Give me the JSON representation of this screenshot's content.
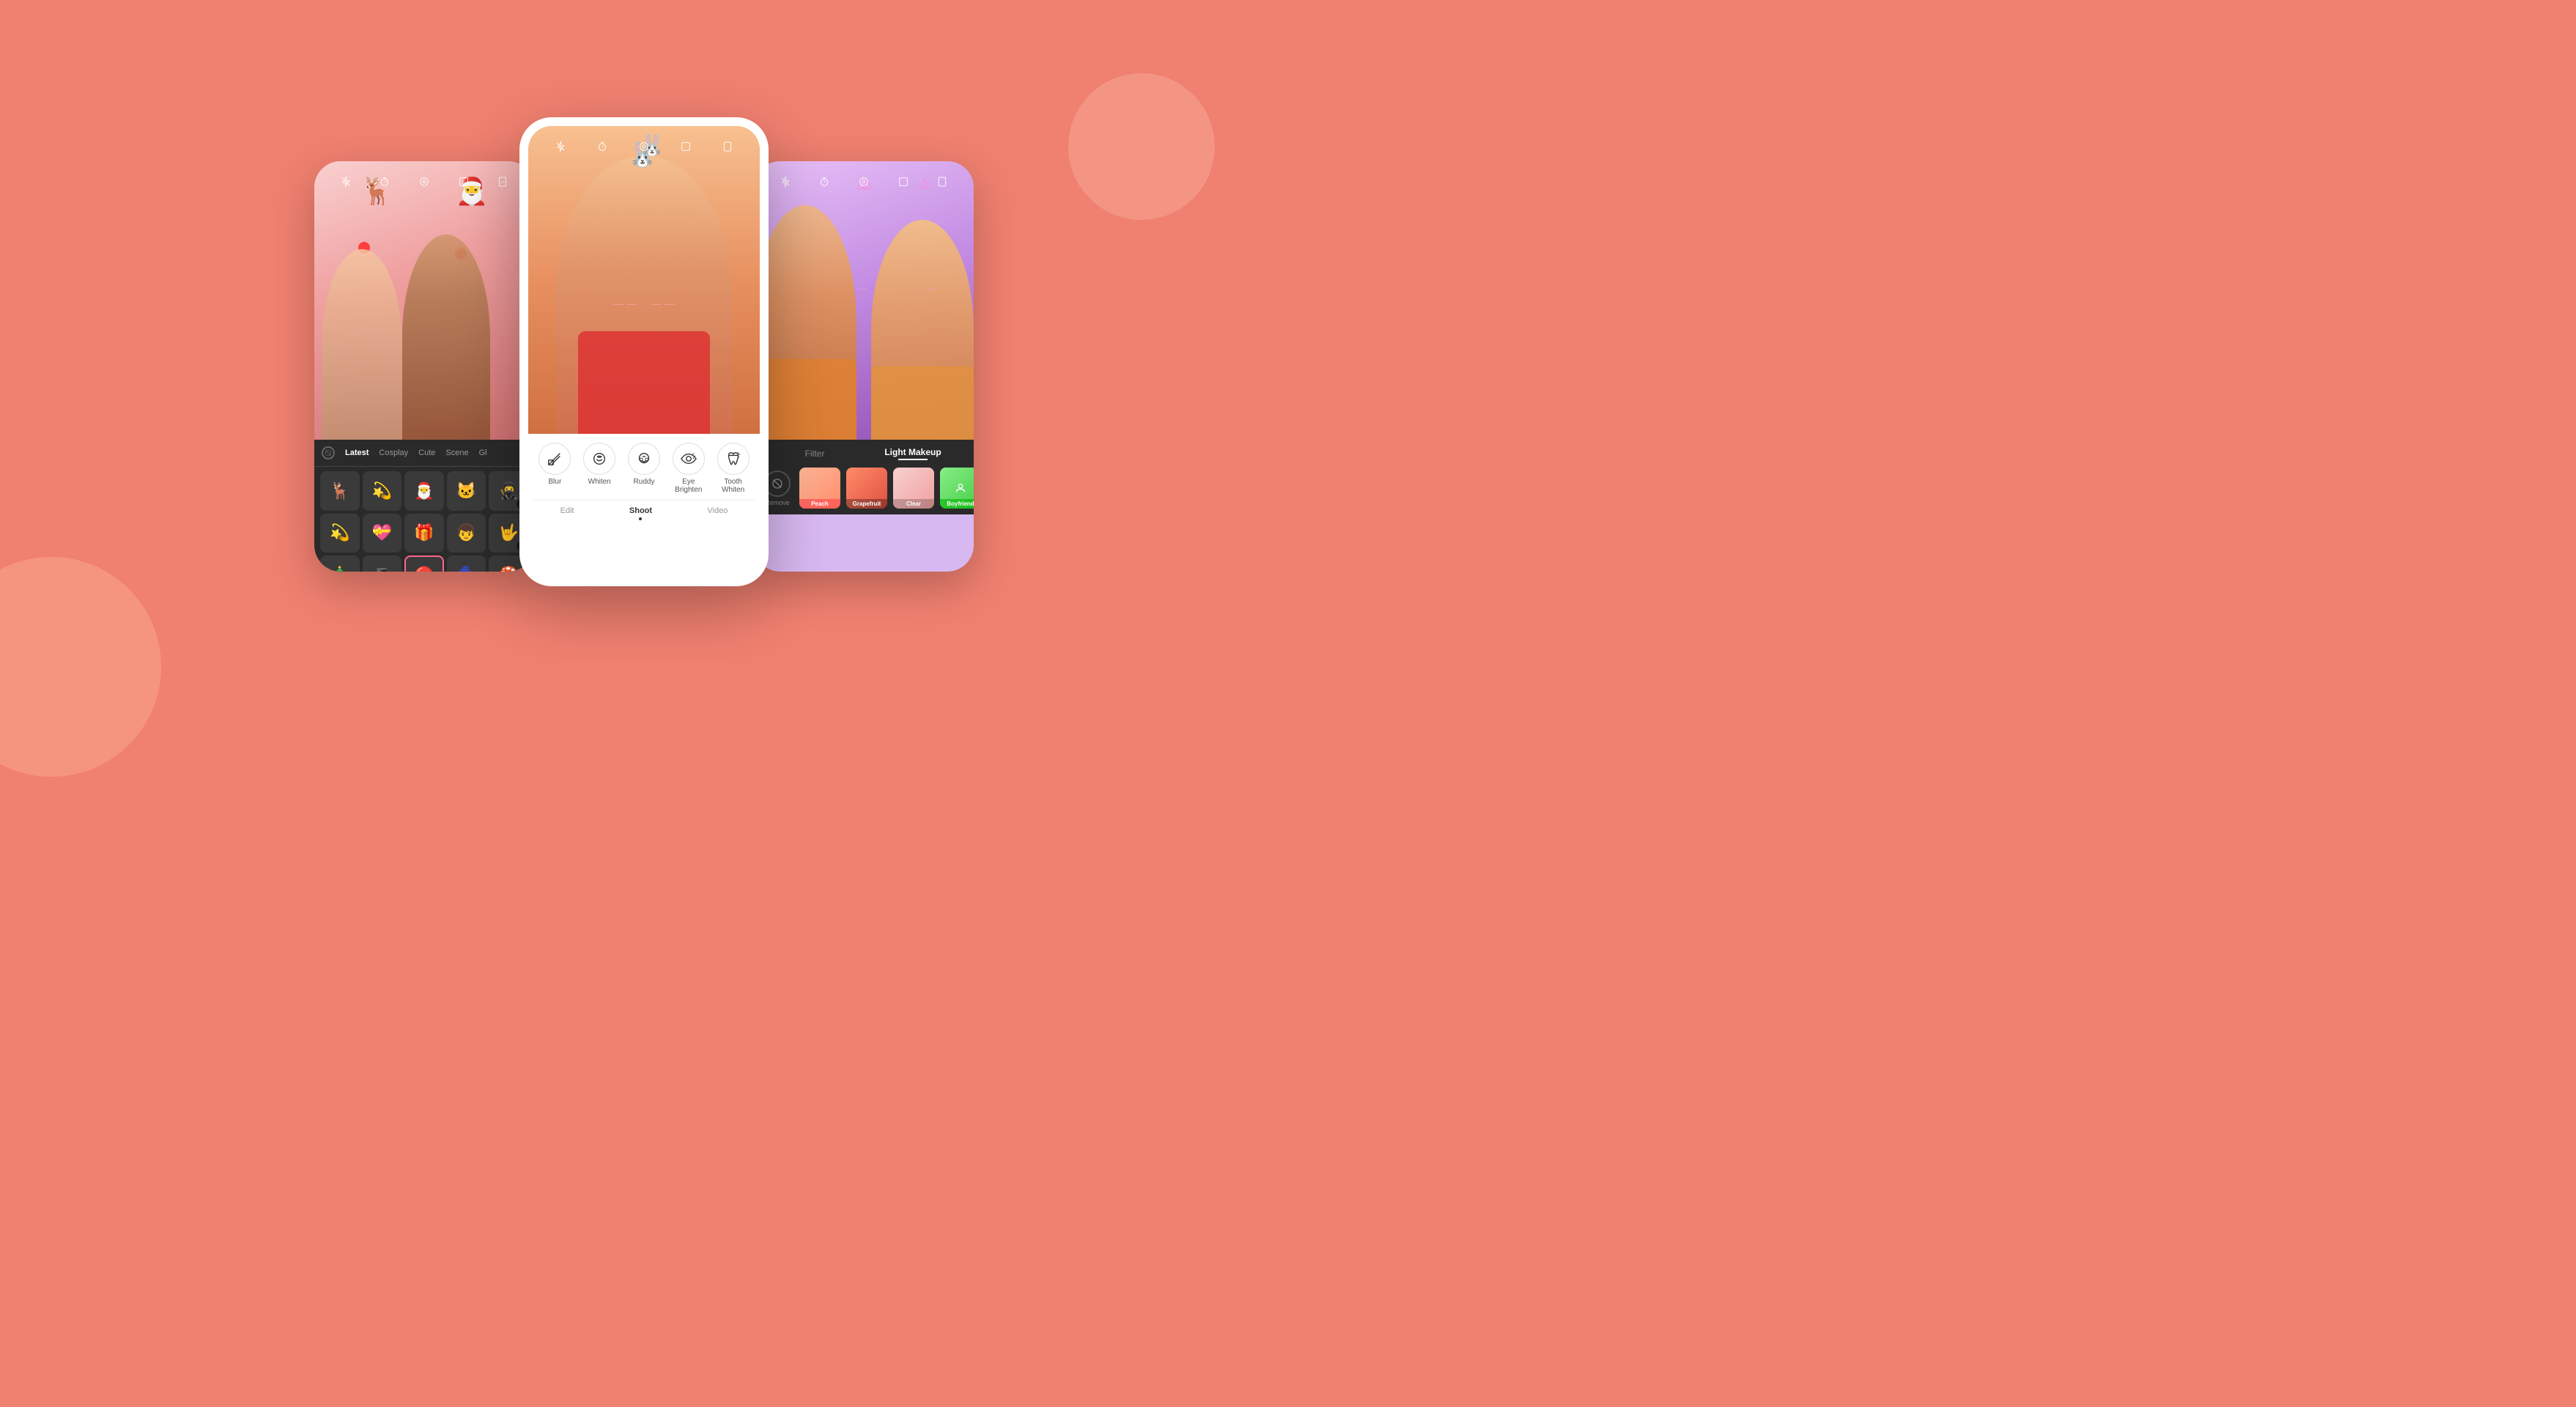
{
  "background": {
    "color": "#f08070"
  },
  "left_phone": {
    "bg_color": "#f8c0c0",
    "filter_tabs": {
      "no_filter_label": "⊘",
      "tabs": [
        "Latest",
        "Cosplay",
        "Cute",
        "Scene",
        "Gl"
      ]
    },
    "stickers": [
      {
        "emoji": "🎄",
        "downloaded": false
      },
      {
        "emoji": "🦌",
        "downloaded": false
      },
      {
        "emoji": "🎅",
        "downloaded": false
      },
      {
        "emoji": "🐱",
        "downloaded": false
      },
      {
        "emoji": "🥷",
        "downloaded": true
      },
      {
        "emoji": "💫",
        "downloaded": false
      },
      {
        "emoji": "💝",
        "downloaded": false
      },
      {
        "emoji": "🎁",
        "downloaded": false
      },
      {
        "emoji": "👦",
        "downloaded": false
      },
      {
        "emoji": "🤟",
        "downloaded": true
      },
      {
        "emoji": "🎄",
        "downloaded": false
      },
      {
        "emoji": "🎩",
        "downloaded": true
      },
      {
        "emoji": "🔴",
        "downloaded": false,
        "selected": true
      },
      {
        "emoji": "🧙",
        "downloaded": true
      },
      {
        "emoji": "🍄",
        "downloaded": true
      }
    ],
    "toolbar_icons": [
      "flash-off",
      "timer",
      "circle",
      "1:1",
      "3:4"
    ]
  },
  "center_phone": {
    "bg_color": "#f5b896",
    "beauty_items": [
      {
        "label": "Blur",
        "icon": "lipstick"
      },
      {
        "label": "Whiten",
        "icon": "face-smile"
      },
      {
        "label": "Ruddy",
        "icon": "face-blush"
      },
      {
        "label": "Eye Brighten",
        "icon": "eye"
      },
      {
        "label": "Tooth Whiten",
        "icon": "tooth"
      }
    ],
    "nav_tabs": [
      {
        "label": "Edit",
        "active": false
      },
      {
        "label": "Shoot",
        "active": true
      },
      {
        "label": "Video",
        "active": false
      }
    ],
    "toolbar_icons": [
      "flash-off",
      "timer",
      "circle",
      "1:1",
      "3:4"
    ]
  },
  "right_phone": {
    "bg_color": "#d4a8f0",
    "makeup_tabs": [
      {
        "label": "Filter",
        "active": false
      },
      {
        "label": "Light Makeup",
        "active": true
      }
    ],
    "filters": [
      {
        "name": "Remove",
        "type": "remove"
      },
      {
        "name": "Peach",
        "type": "peach"
      },
      {
        "name": "Grapefruit",
        "type": "grapefruit"
      },
      {
        "name": "Clear",
        "type": "clear"
      },
      {
        "name": "Boyfriend",
        "type": "boyfriend"
      }
    ],
    "toolbar_icons": [
      "flash-off",
      "timer",
      "circle",
      "1:1",
      "3:4"
    ]
  }
}
